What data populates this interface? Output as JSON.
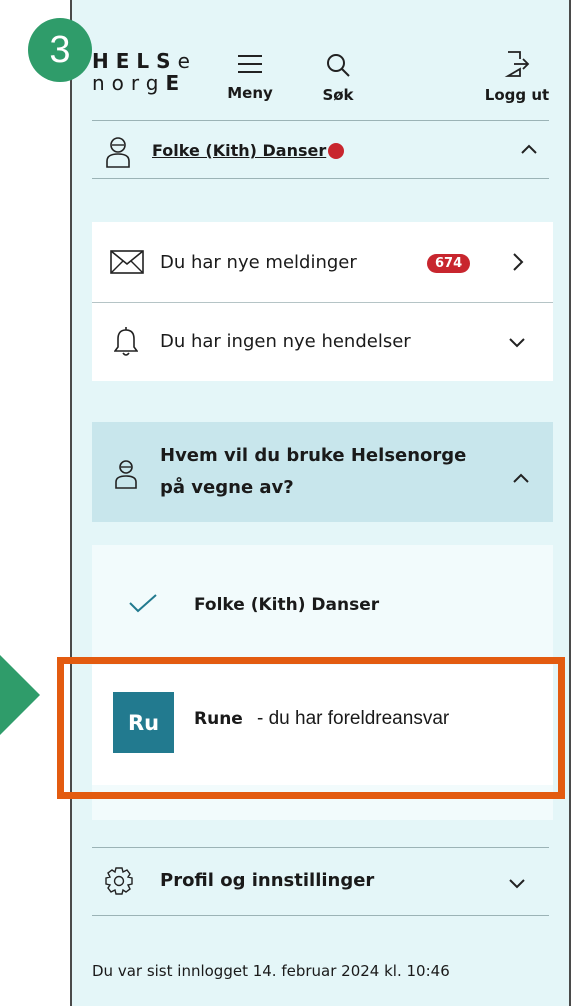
{
  "step_number": "3",
  "logo": {
    "line1_bold": "HELS",
    "line1_light": "e",
    "line2_light": "norg",
    "line2_bold": "E"
  },
  "header": {
    "menu_label": "Meny",
    "search_label": "Søk",
    "logout_label": "Logg ut"
  },
  "user": {
    "name": "Folke (Kith) Danser"
  },
  "notifications": {
    "messages_label": "Du har nye meldinger",
    "messages_count": "674",
    "events_label": "Du har ingen nye hendelser"
  },
  "represent": {
    "title": "Hvem vil du bruke Helsenorge på vegne av?",
    "options": [
      {
        "name": "Folke (Kith) Danser",
        "selected": true
      },
      {
        "avatar": "Ru",
        "name": "Rune",
        "desc": "- du har foreldreansvar"
      }
    ]
  },
  "profile": {
    "label": "Profil og innstillinger"
  },
  "footer": {
    "last_login": "Du var sist innlogget 14. februar 2024 kl. 10:46"
  },
  "colors": {
    "accent_red": "#c8262e",
    "avatar_teal": "#227a8f",
    "highlight_orange": "#e35b10",
    "step_green": "#2f9c6a"
  }
}
